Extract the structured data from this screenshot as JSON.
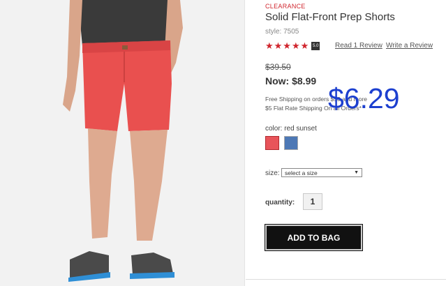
{
  "product": {
    "badge": "CLEARANCE",
    "title": "Solid Flat-Front Prep Shorts",
    "style": "style: 7505",
    "stars_text": "★★★★★",
    "rating": "5.0",
    "read_review": "Read 1 Review",
    "write_review": "Write a Review",
    "was_price": "$39.50",
    "now_price": "Now: $8.99",
    "shipping_line1": "Free Shipping on orders $50 and more",
    "shipping_line2": "$5 Flat Rate Shipping On all Orders*",
    "overlay_price": "$6.29",
    "color_label": "color: red sunset",
    "swatches": [
      {
        "name": "red sunset",
        "color": "#e8545a"
      },
      {
        "name": "blue",
        "color": "#4d78b5"
      }
    ],
    "size_label": "size:",
    "size_placeholder": "select a size",
    "quantity_label": "quantity:",
    "quantity_value": "1",
    "add_to_bag": "ADD TO BAG"
  },
  "colors": {
    "accent_red": "#d0252d",
    "shorts": "#e9504f",
    "button": "#111111",
    "overlay_blue": "#1c3fcf"
  }
}
